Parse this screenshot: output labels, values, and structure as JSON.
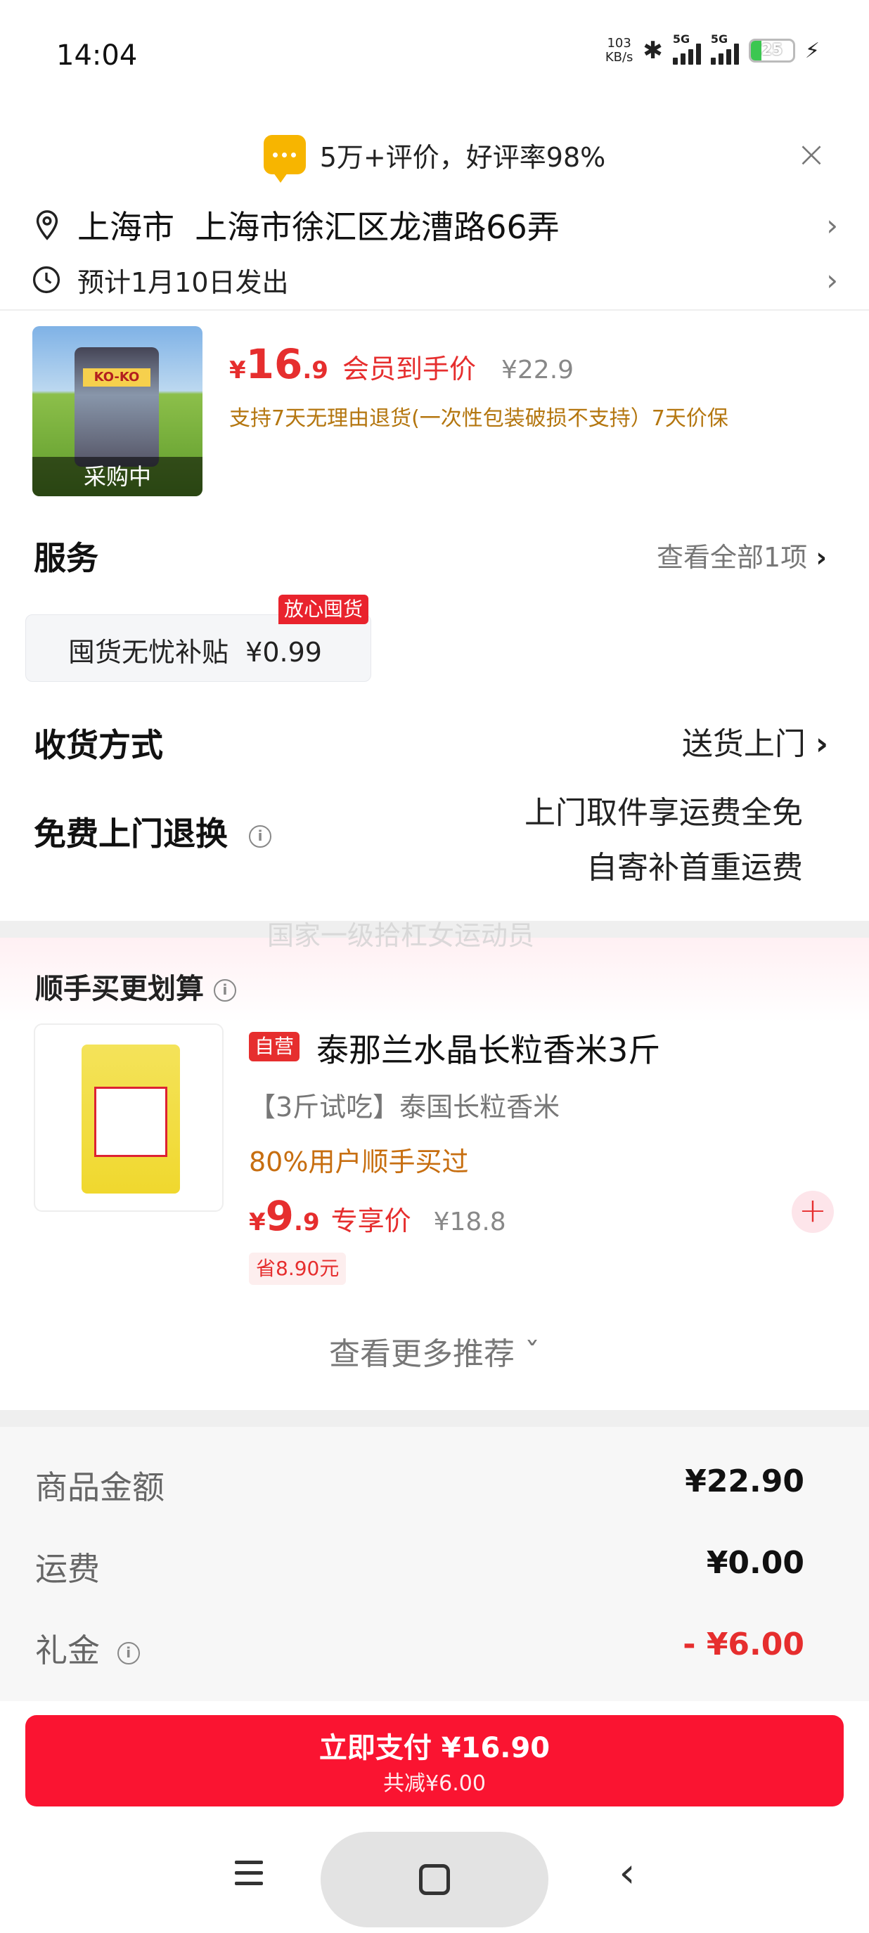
{
  "status_bar": {
    "time": "14:04",
    "net_speed_value": "103",
    "net_speed_unit": "KB/s",
    "bluetooth_icon": "bluetooth-icon",
    "sim1_label": "5G",
    "sim2_label": "5G",
    "battery_level": "25",
    "battery_color": "#3cc751"
  },
  "review_banner": {
    "text": "5万+评价，好评率98%",
    "icon": "chat-bubble-icon"
  },
  "address": {
    "city": "上海市",
    "detail": "上海市徐汇区龙漕路66弄",
    "full": "上海市  上海市徐汇区龙漕路66弄",
    "ship_estimate": "预计1月10日发出"
  },
  "product": {
    "image_badge": "采购中",
    "bag_logo": "KO-KO",
    "price_yen": "¥",
    "price_int": "16",
    "price_dec": ".9",
    "price_tag": "会员到手价",
    "original_price": "¥22.9",
    "return_note": "支持7天无理由退货(一次性包装破损不支持）7天价保"
  },
  "service": {
    "title": "服务",
    "view_all": "查看全部1项",
    "item_label": "囤货无忧补贴  ¥0.99",
    "item_tag": "放心囤货"
  },
  "receive": {
    "title": "收货方式",
    "value": "送货上门"
  },
  "free_return": {
    "title": "免费上门退换",
    "line1": "上门取件享运费全免",
    "line2": "自寄补首重运费"
  },
  "watermark": "国家一级拾杠女运动员",
  "bundle": {
    "title": "顺手买更划算",
    "self_tag": "自营",
    "name": "泰那兰水晶长粒香米3斤",
    "subtitle": "【3斤试吃】泰国长粒香米",
    "bought_note": "80%用户顺手买过",
    "price_yen": "¥",
    "price_int": "9",
    "price_dec": ".9",
    "price_tag": "专享价",
    "original_price": "¥18.8",
    "save_tag": "省8.90元",
    "add_symbol": "+"
  },
  "more_recommend": "查看更多推荐 ˇ",
  "summary": {
    "goods_label": "商品金额",
    "goods_value": "¥22.90",
    "shipping_label": "运费",
    "shipping_value": "¥0.00",
    "gift_label": "礼金",
    "gift_value": "- ¥6.00"
  },
  "pay_button": {
    "main": "立即支付 ¥16.90",
    "sub": "共减¥6.00",
    "color": "#fa1431"
  },
  "accent_red": "#e62e2e",
  "nav": {
    "menu_icon": "menu-icon",
    "home_icon": "home-square-icon",
    "back_icon": "back-chevron-icon"
  }
}
